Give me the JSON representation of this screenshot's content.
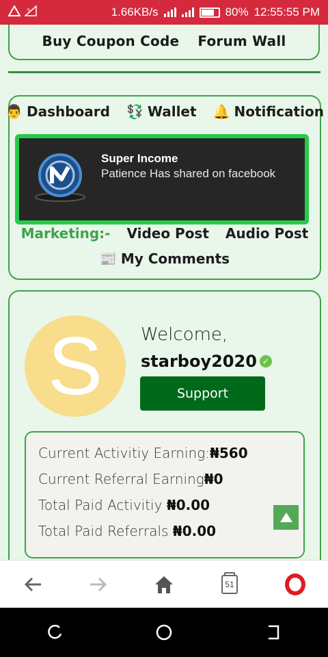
{
  "status_bar": {
    "network_speed": "1.66KB/s",
    "battery_percent": "80%",
    "battery_level": 0.8,
    "time": "12:55:55 PM"
  },
  "top_links": [
    "Buy Coupon Code",
    "Forum Wall"
  ],
  "nav": {
    "row1": [
      {
        "icon": "👨",
        "label": "Dashboard"
      },
      {
        "icon": "💱",
        "label": "Wallet"
      },
      {
        "icon": "🔔",
        "label": "Notification"
      }
    ],
    "marketing_label": "Marketing:-",
    "marketing_items": [
      "Video Post",
      "Audio Post"
    ],
    "comments": {
      "icon": "📰",
      "label": "My Comments"
    }
  },
  "notification": {
    "title": "Super Income",
    "text": "Patience Has shared on facebook"
  },
  "profile": {
    "avatar_letter": "S",
    "welcome": "Welcome,",
    "username": "starboy2020",
    "support_label": "Support"
  },
  "stats": [
    {
      "label": "Current Activitiy Earning:",
      "value": "₦560"
    },
    {
      "label": "Current Referral Earning",
      "value": "₦0"
    },
    {
      "label": "Total Paid Activitiy ",
      "value": "₦0.00"
    },
    {
      "label": "Total Paid Referrals ",
      "value": "₦0.00"
    }
  ],
  "browser": {
    "tab_count": "51"
  },
  "colors": {
    "status_bar": "#d52a3d",
    "accent_green": "#3fa24a",
    "support_button": "#006a1a",
    "notification_border": "#26c94a"
  }
}
